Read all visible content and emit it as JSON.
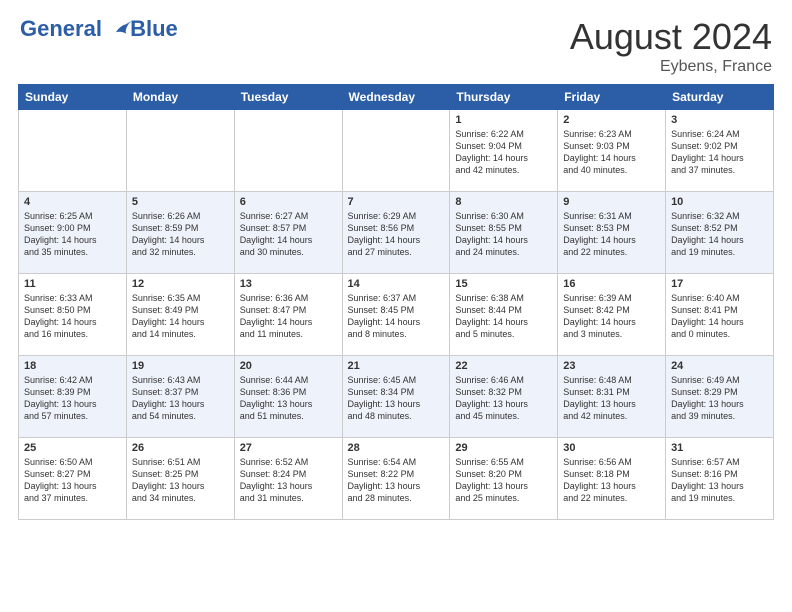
{
  "header": {
    "logo_text_line1": "General",
    "logo_text_line2": "Blue",
    "month_year": "August 2024",
    "location": "Eybens, France"
  },
  "weekdays": [
    "Sunday",
    "Monday",
    "Tuesday",
    "Wednesday",
    "Thursday",
    "Friday",
    "Saturday"
  ],
  "weeks": [
    [
      {
        "day": "",
        "info": ""
      },
      {
        "day": "",
        "info": ""
      },
      {
        "day": "",
        "info": ""
      },
      {
        "day": "",
        "info": ""
      },
      {
        "day": "1",
        "info": "Sunrise: 6:22 AM\nSunset: 9:04 PM\nDaylight: 14 hours\nand 42 minutes."
      },
      {
        "day": "2",
        "info": "Sunrise: 6:23 AM\nSunset: 9:03 PM\nDaylight: 14 hours\nand 40 minutes."
      },
      {
        "day": "3",
        "info": "Sunrise: 6:24 AM\nSunset: 9:02 PM\nDaylight: 14 hours\nand 37 minutes."
      }
    ],
    [
      {
        "day": "4",
        "info": "Sunrise: 6:25 AM\nSunset: 9:00 PM\nDaylight: 14 hours\nand 35 minutes."
      },
      {
        "day": "5",
        "info": "Sunrise: 6:26 AM\nSunset: 8:59 PM\nDaylight: 14 hours\nand 32 minutes."
      },
      {
        "day": "6",
        "info": "Sunrise: 6:27 AM\nSunset: 8:57 PM\nDaylight: 14 hours\nand 30 minutes."
      },
      {
        "day": "7",
        "info": "Sunrise: 6:29 AM\nSunset: 8:56 PM\nDaylight: 14 hours\nand 27 minutes."
      },
      {
        "day": "8",
        "info": "Sunrise: 6:30 AM\nSunset: 8:55 PM\nDaylight: 14 hours\nand 24 minutes."
      },
      {
        "day": "9",
        "info": "Sunrise: 6:31 AM\nSunset: 8:53 PM\nDaylight: 14 hours\nand 22 minutes."
      },
      {
        "day": "10",
        "info": "Sunrise: 6:32 AM\nSunset: 8:52 PM\nDaylight: 14 hours\nand 19 minutes."
      }
    ],
    [
      {
        "day": "11",
        "info": "Sunrise: 6:33 AM\nSunset: 8:50 PM\nDaylight: 14 hours\nand 16 minutes."
      },
      {
        "day": "12",
        "info": "Sunrise: 6:35 AM\nSunset: 8:49 PM\nDaylight: 14 hours\nand 14 minutes."
      },
      {
        "day": "13",
        "info": "Sunrise: 6:36 AM\nSunset: 8:47 PM\nDaylight: 14 hours\nand 11 minutes."
      },
      {
        "day": "14",
        "info": "Sunrise: 6:37 AM\nSunset: 8:45 PM\nDaylight: 14 hours\nand 8 minutes."
      },
      {
        "day": "15",
        "info": "Sunrise: 6:38 AM\nSunset: 8:44 PM\nDaylight: 14 hours\nand 5 minutes."
      },
      {
        "day": "16",
        "info": "Sunrise: 6:39 AM\nSunset: 8:42 PM\nDaylight: 14 hours\nand 3 minutes."
      },
      {
        "day": "17",
        "info": "Sunrise: 6:40 AM\nSunset: 8:41 PM\nDaylight: 14 hours\nand 0 minutes."
      }
    ],
    [
      {
        "day": "18",
        "info": "Sunrise: 6:42 AM\nSunset: 8:39 PM\nDaylight: 13 hours\nand 57 minutes."
      },
      {
        "day": "19",
        "info": "Sunrise: 6:43 AM\nSunset: 8:37 PM\nDaylight: 13 hours\nand 54 minutes."
      },
      {
        "day": "20",
        "info": "Sunrise: 6:44 AM\nSunset: 8:36 PM\nDaylight: 13 hours\nand 51 minutes."
      },
      {
        "day": "21",
        "info": "Sunrise: 6:45 AM\nSunset: 8:34 PM\nDaylight: 13 hours\nand 48 minutes."
      },
      {
        "day": "22",
        "info": "Sunrise: 6:46 AM\nSunset: 8:32 PM\nDaylight: 13 hours\nand 45 minutes."
      },
      {
        "day": "23",
        "info": "Sunrise: 6:48 AM\nSunset: 8:31 PM\nDaylight: 13 hours\nand 42 minutes."
      },
      {
        "day": "24",
        "info": "Sunrise: 6:49 AM\nSunset: 8:29 PM\nDaylight: 13 hours\nand 39 minutes."
      }
    ],
    [
      {
        "day": "25",
        "info": "Sunrise: 6:50 AM\nSunset: 8:27 PM\nDaylight: 13 hours\nand 37 minutes."
      },
      {
        "day": "26",
        "info": "Sunrise: 6:51 AM\nSunset: 8:25 PM\nDaylight: 13 hours\nand 34 minutes."
      },
      {
        "day": "27",
        "info": "Sunrise: 6:52 AM\nSunset: 8:24 PM\nDaylight: 13 hours\nand 31 minutes."
      },
      {
        "day": "28",
        "info": "Sunrise: 6:54 AM\nSunset: 8:22 PM\nDaylight: 13 hours\nand 28 minutes."
      },
      {
        "day": "29",
        "info": "Sunrise: 6:55 AM\nSunset: 8:20 PM\nDaylight: 13 hours\nand 25 minutes."
      },
      {
        "day": "30",
        "info": "Sunrise: 6:56 AM\nSunset: 8:18 PM\nDaylight: 13 hours\nand 22 minutes."
      },
      {
        "day": "31",
        "info": "Sunrise: 6:57 AM\nSunset: 8:16 PM\nDaylight: 13 hours\nand 19 minutes."
      }
    ]
  ]
}
